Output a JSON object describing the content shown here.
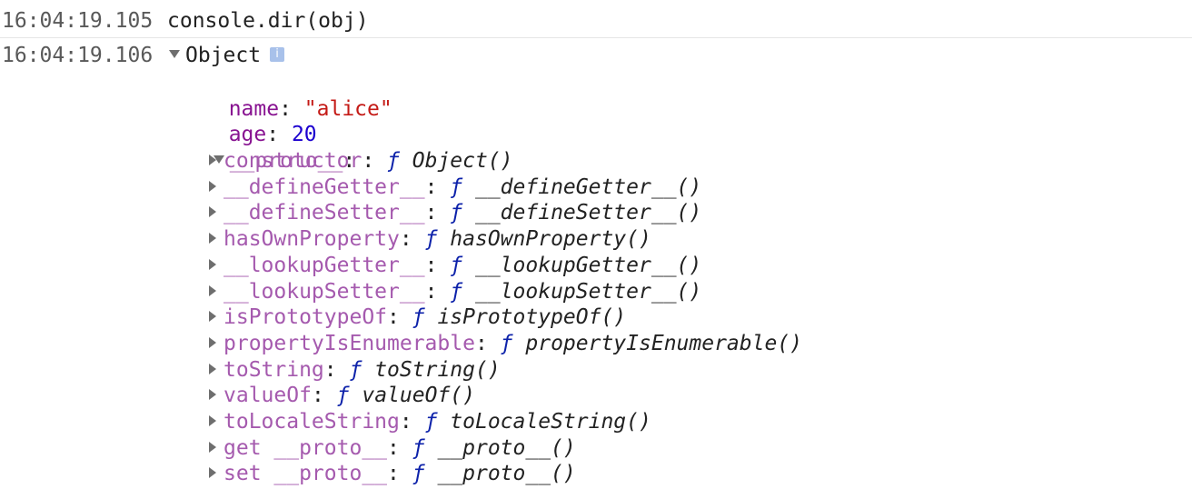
{
  "console": {
    "command": {
      "timestamp": "16:04:19.105",
      "text": "console.dir(obj)"
    },
    "result": {
      "timestamp": "16:04:19.106",
      "label": "Object",
      "info_icon_glyph": "i",
      "properties": [
        {
          "key": "name",
          "value": "\"alice\""
        },
        {
          "key": "age",
          "value": "20"
        }
      ],
      "proto": {
        "key": "__proto__",
        "f_symbol": "ƒ",
        "entries": [
          {
            "key": "constructor",
            "fn": "Object()"
          },
          {
            "key": "__defineGetter__",
            "fn": "__defineGetter__()"
          },
          {
            "key": "__defineSetter__",
            "fn": "__defineSetter__()"
          },
          {
            "key": "hasOwnProperty",
            "fn": "hasOwnProperty()"
          },
          {
            "key": "__lookupGetter__",
            "fn": "__lookupGetter__()"
          },
          {
            "key": "__lookupSetter__",
            "fn": "__lookupSetter__()"
          },
          {
            "key": "isPrototypeOf",
            "fn": "isPrototypeOf()"
          },
          {
            "key": "propertyIsEnumerable",
            "fn": "propertyIsEnumerable()"
          },
          {
            "key": "toString",
            "fn": "toString()"
          },
          {
            "key": "valueOf",
            "fn": "valueOf()"
          },
          {
            "key": "toLocaleString",
            "fn": "toLocaleString()"
          },
          {
            "key": "get __proto__",
            "fn": "__proto__()"
          },
          {
            "key": "set __proto__",
            "fn": "__proto__()"
          }
        ]
      }
    }
  },
  "colors": {
    "own_key": "#881391",
    "proto_key": "#a55aae",
    "string": "#c41a16",
    "number": "#1c00cf",
    "function_symbol": "#0d22aa",
    "timestamp": "#595959"
  }
}
